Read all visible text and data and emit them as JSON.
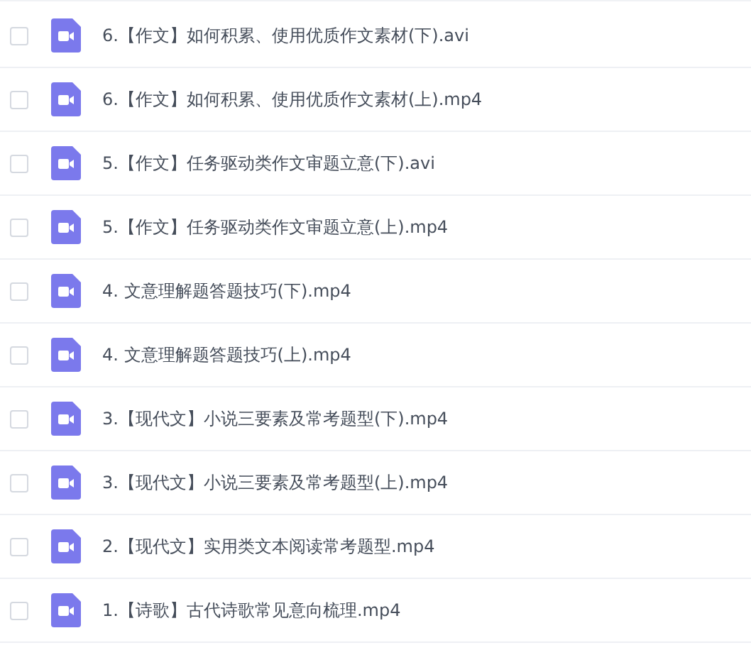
{
  "files": [
    {
      "name": "6.【作文】如何积累、使用优质作文素材(下).avi",
      "checked": false
    },
    {
      "name": "6.【作文】如何积累、使用优质作文素材(上).mp4",
      "checked": false
    },
    {
      "name": "5.【作文】任务驱动类作文审题立意(下).avi",
      "checked": false
    },
    {
      "name": "5.【作文】任务驱动类作文审题立意(上).mp4",
      "checked": false
    },
    {
      "name": "4. 文意理解题答题技巧(下).mp4",
      "checked": false
    },
    {
      "name": "4. 文意理解题答题技巧(上).mp4",
      "checked": false
    },
    {
      "name": "3.【现代文】小说三要素及常考题型(下).mp4",
      "checked": false
    },
    {
      "name": "3.【现代文】小说三要素及常考题型(上).mp4",
      "checked": false
    },
    {
      "name": "2.【现代文】实用类文本阅读常考题型.mp4",
      "checked": false
    },
    {
      "name": "1.【诗歌】古代诗歌常见意向梳理.mp4",
      "checked": false
    }
  ]
}
